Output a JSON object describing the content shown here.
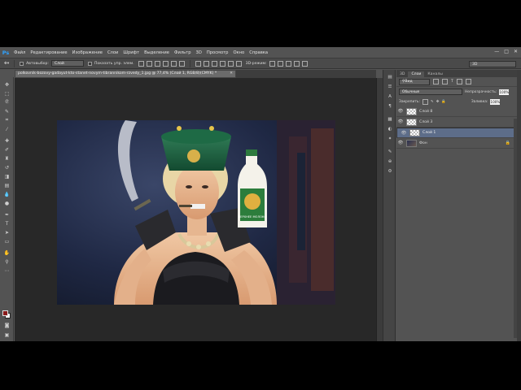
{
  "app": {
    "logo": "Ps",
    "menu": [
      "Файл",
      "Редактирование",
      "Изображение",
      "Слои",
      "Шрифт",
      "Выделение",
      "Фильтр",
      "3D",
      "Просмотр",
      "Окно",
      "Справка"
    ],
    "window_controls": [
      "—",
      "□",
      "✕"
    ]
  },
  "options_bar": {
    "autoselect_label": "Автовыбор:",
    "autoselect_value": "Слой",
    "show_transform_label": "Показать упр. элем.",
    "mode_3d_label": "3D-режим:",
    "workspace_value": "3D"
  },
  "document": {
    "tab_title": "polkovnik-bozovy-gadayut-kto-stanet-novym-tibrannikom-rzvedy_1.jpg @ 77,4% (Слой 1, RGB/8)(CMYK) *",
    "close": "✕"
  },
  "tools": [
    "move-tool",
    "marquee-tool",
    "lasso-tool",
    "quick-select-tool",
    "crop-tool",
    "eyedropper-tool",
    "healing-tool",
    "brush-tool",
    "stamp-tool",
    "history-brush-tool",
    "eraser-tool",
    "gradient-tool",
    "blur-tool",
    "dodge-tool",
    "pen-tool",
    "type-tool",
    "path-select-tool",
    "shape-tool",
    "hand-tool",
    "zoom-tool"
  ],
  "colors": {
    "foreground": "#8a1a1a",
    "background": "#ffffff",
    "selection_highlight": "#5d6d89",
    "ps_blue": "#2fa3ff"
  },
  "panels": {
    "top_tabs": [
      "3D",
      "Слои",
      "Каналы"
    ],
    "active_tab": "Слои",
    "kind_filter": "Вид",
    "blend_mode": "Обычные",
    "opacity_label": "Непрозрачность:",
    "opacity_value": "100%",
    "lock_label": "Закрепить:",
    "fill_label": "Заливка:",
    "fill_value": "100%",
    "layers": [
      {
        "name": "Слой 8",
        "visible": true,
        "selected": false,
        "locked": false
      },
      {
        "name": "Слой 3",
        "visible": true,
        "selected": false,
        "locked": false
      },
      {
        "name": "Слой 1",
        "visible": true,
        "selected": true,
        "locked": false
      },
      {
        "name": "Фон",
        "visible": true,
        "selected": false,
        "locked": true
      }
    ]
  },
  "bottle_label": "ВЕРХНЕЕ МОЛОКО"
}
